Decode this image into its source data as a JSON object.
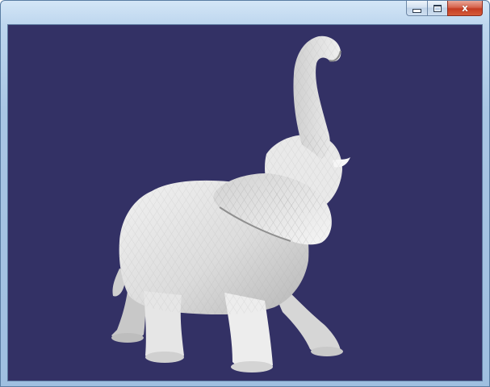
{
  "window": {
    "title": "",
    "close_glyph": "x",
    "viewport_background": "#333165",
    "model_color": "#e4e4e4",
    "model_name": "elephant"
  }
}
